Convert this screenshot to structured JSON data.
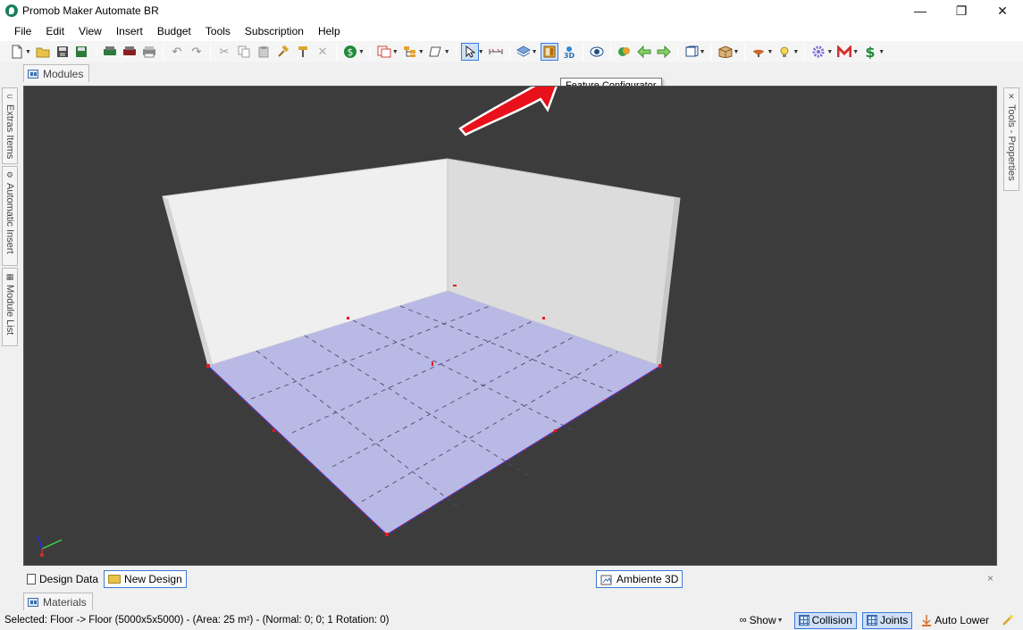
{
  "window": {
    "title": "Promob Maker Automate BR",
    "controls": {
      "minimize": "—",
      "restore": "❐",
      "close": "✕"
    }
  },
  "menu": [
    "File",
    "Edit",
    "View",
    "Insert",
    "Budget",
    "Tools",
    "Subscription",
    "Help"
  ],
  "tooltip": "Feature Configurator",
  "top_tab": "Modules",
  "left_panels": [
    "Extras Items",
    "Automatic Insert",
    "Module List"
  ],
  "right_panel": "Tools - Properties",
  "bottom_tabs": {
    "design_data": "Design Data",
    "new_design": "New Design",
    "ambiente": "Ambiente 3D",
    "close": "×"
  },
  "materials_tab": "Materials",
  "status": {
    "text": "Selected: Floor -> Floor (5000x5x5000) - (Area: 25 m²) - (Normal: 0; 0; 1 Rotation: 0)",
    "show": "Show",
    "collision": "Collision",
    "joints": "Joints",
    "auto_lower": "Auto Lower"
  },
  "colors": {
    "viewport_bg": "#3c3c3c",
    "floor": "#b9b9e6",
    "wall_left": "#efefef",
    "wall_right": "#dcdcdc",
    "annotation_arrow": "#e8101a",
    "accent": "#3b7ad9"
  }
}
